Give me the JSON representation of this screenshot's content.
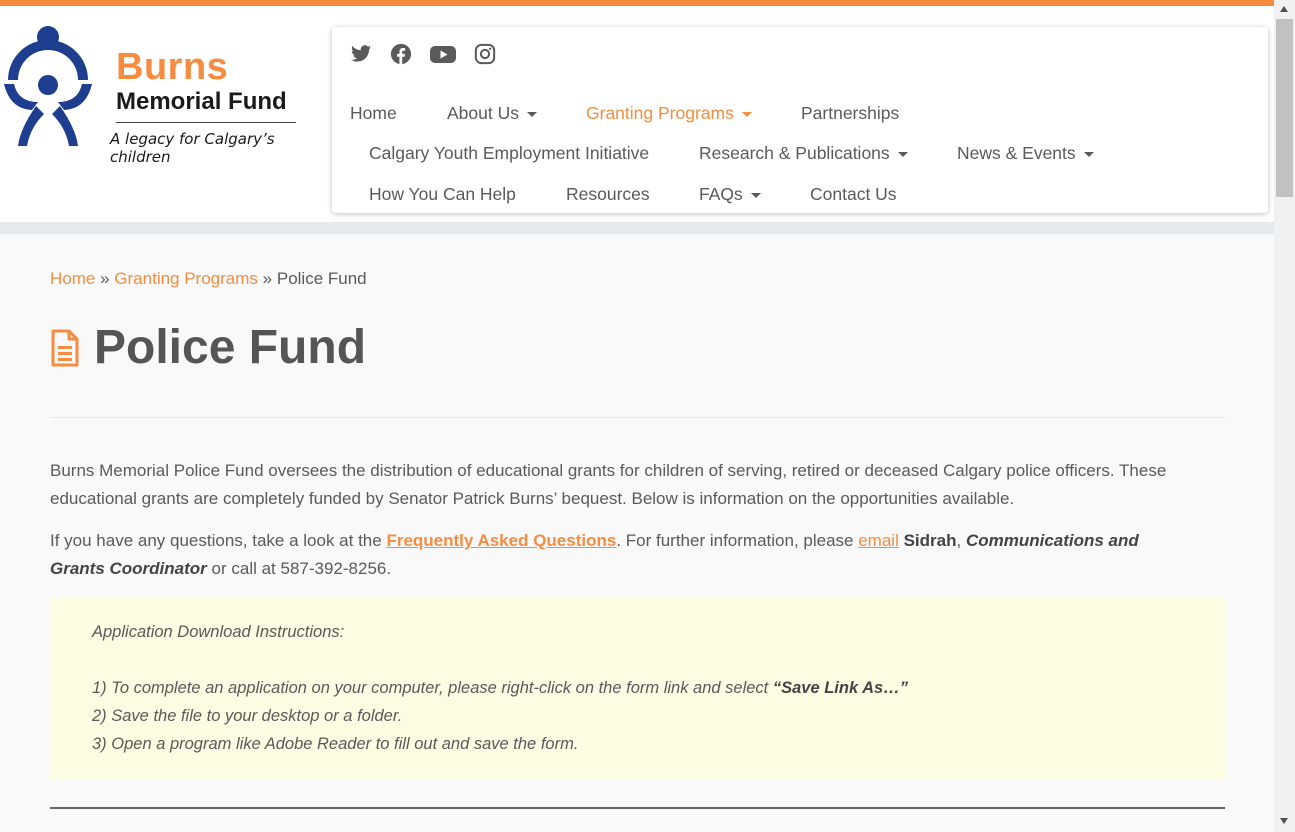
{
  "colors": {
    "accent": "#f78c40",
    "logo_blue": "#1f3e8f",
    "text": "#5a5a5a",
    "instructions_bg": "#fcfce3"
  },
  "logo": {
    "line1": "Burns",
    "line2": "Memorial Fund",
    "tagline": "A legacy for Calgary’s children"
  },
  "social": [
    "twitter-icon",
    "facebook-icon",
    "youtube-icon",
    "instagram-icon"
  ],
  "nav": {
    "home": "Home",
    "about": "About Us",
    "granting": "Granting Programs",
    "partnerships": "Partnerships",
    "cyei": "Calgary Youth Employment Initiative",
    "research": "Research & Publications",
    "news": "News & Events",
    "help": "How You Can Help",
    "resources": "Resources",
    "faqs": "FAQs",
    "contact": "Contact Us"
  },
  "breadcrumb": {
    "home": "Home",
    "sep1": "»",
    "granting": "Granting Programs",
    "sep2": "»",
    "current": "Police Fund"
  },
  "page": {
    "title": "Police Fund"
  },
  "intro": {
    "line1": "Burns Memorial Police Fund oversees the distribution of educational grants for children of serving, retired or deceased Calgary police officers. These",
    "line2": "educational grants are completely funded by Senator Patrick Burns’ bequest. Below is information on the opportunities available."
  },
  "contact_para": {
    "pre": "If you have any questions, take a look at the ",
    "faq_link": "Frequently Asked Questions",
    "mid": ". For further information, please ",
    "email_link": "email",
    "name": "Sidrah",
    "comma": ", ",
    "role_part1": "Communications and",
    "role_part2": "Grants Coordinator",
    "post": " or call at 587-392-8256."
  },
  "instructions": {
    "heading": "Application Download Instructions:",
    "step1_pre": "1) To complete an application on your computer, please right-click on the form link and select ",
    "step1_bold": "“Save Link As…”",
    "step2": "2) Save the file to your desktop or a folder.",
    "step3": "3) Open a program like Adobe Reader to fill out and save the form."
  }
}
